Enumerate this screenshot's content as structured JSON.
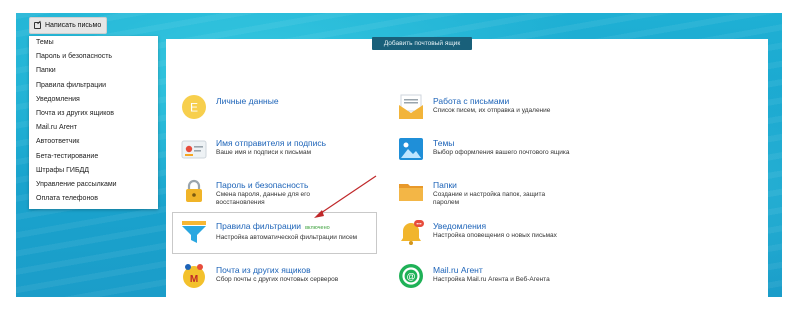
{
  "compose": {
    "label": "Написать письмо"
  },
  "menu": {
    "items": [
      {
        "label": "Темы"
      },
      {
        "label": "Пароль и безопасность"
      },
      {
        "label": "Папки"
      },
      {
        "label": "Правила фильтрации"
      },
      {
        "label": "Уведомления"
      },
      {
        "label": "Почта из других ящиков"
      },
      {
        "label": "Mail.ru Агент"
      },
      {
        "label": "Автоответчик"
      },
      {
        "label": "Бета-тестирование"
      },
      {
        "label": "Штрафы ГИБДД"
      },
      {
        "label": "Управление рассылками"
      },
      {
        "label": "Оплата телефонов"
      }
    ]
  },
  "add_mailbox": {
    "label": "Добавить почтовый ящик"
  },
  "settings": {
    "left": [
      {
        "title": "Личные данные",
        "desc": "",
        "icon": "letter-e-icon",
        "color": "#f5c542"
      },
      {
        "title": "Имя отправителя и подпись",
        "desc": "Ваше имя и подписи к письмам",
        "icon": "id-card-icon",
        "color": "#e74c3c"
      },
      {
        "title": "Пароль и безопасность",
        "desc": "Смена пароля, данные для его восстановления",
        "icon": "lock-icon",
        "color": "#f0b428"
      },
      {
        "title": "Правила фильтрации",
        "badge": "включено",
        "desc": "Настройка автоматической фильтрации писем",
        "icon": "funnel-icon",
        "color": "#2aa7e0"
      },
      {
        "title": "Почта из других ящиков",
        "desc": "Сбор почты с других почтовых серверов",
        "icon": "mailbox-collect-icon",
        "color": "#f3c12c"
      }
    ],
    "right": [
      {
        "title": "Работа с письмами",
        "desc": "Список писем, их отправка и удаление",
        "icon": "envelope-icon",
        "color": "#f2b43a"
      },
      {
        "title": "Темы",
        "desc": "Выбор оформления вашего почтового ящика",
        "icon": "picture-icon",
        "color": "#1f8fd8"
      },
      {
        "title": "Папки",
        "desc": "Создание и настройка папок, защита паролем",
        "icon": "folder-icon",
        "color": "#f0a93a"
      },
      {
        "title": "Уведомления",
        "desc": "Настройка оповещения о новых письмах",
        "icon": "bell-icon",
        "color": "#f1b52c"
      },
      {
        "title": "Mail.ru Агент",
        "desc": "Настройка Mail.ru Агента и Веб-Агента",
        "icon": "agent-icon",
        "color": "#1fb157"
      }
    ]
  },
  "annotation": {
    "arrow_color": "#c0282a"
  }
}
